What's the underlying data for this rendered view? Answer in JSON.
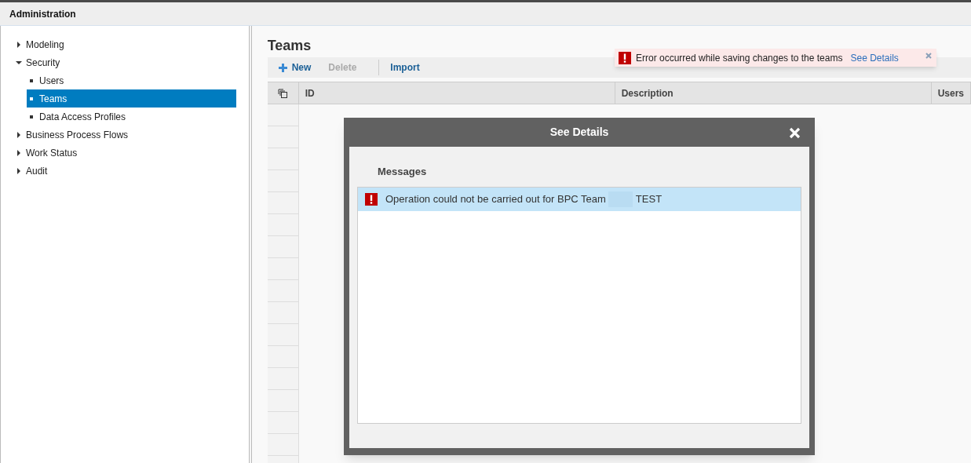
{
  "header": {
    "title": "Administration"
  },
  "sidebar": {
    "items": [
      {
        "label": "Modeling",
        "expanded": false,
        "selected": false
      },
      {
        "label": "Security",
        "expanded": true,
        "selected": false,
        "children": [
          {
            "label": "Users",
            "selected": false
          },
          {
            "label": "Teams",
            "selected": true
          },
          {
            "label": "Data Access Profiles",
            "selected": false
          }
        ]
      },
      {
        "label": "Business Process Flows",
        "expanded": false,
        "selected": false
      },
      {
        "label": "Work Status",
        "expanded": false,
        "selected": false
      },
      {
        "label": "Audit",
        "expanded": false,
        "selected": false
      }
    ]
  },
  "page": {
    "title": "Teams",
    "toolbar": [
      {
        "label": "New",
        "kind": "add",
        "disabled": false
      },
      {
        "label": "Delete",
        "kind": "plain",
        "disabled": true
      },
      {
        "label": "Import",
        "kind": "plain",
        "disabled": false
      }
    ],
    "table": {
      "columns": [
        "ID",
        "Description",
        "Users"
      ]
    }
  },
  "toast": {
    "message": "Error occurred while saving changes to the teams",
    "link": "See Details"
  },
  "dialog": {
    "title": "See Details",
    "section": "Messages",
    "messages": [
      {
        "text": "Operation could not be carried out for BPC Team",
        "suffix": "TEST",
        "selected": true
      }
    ]
  }
}
